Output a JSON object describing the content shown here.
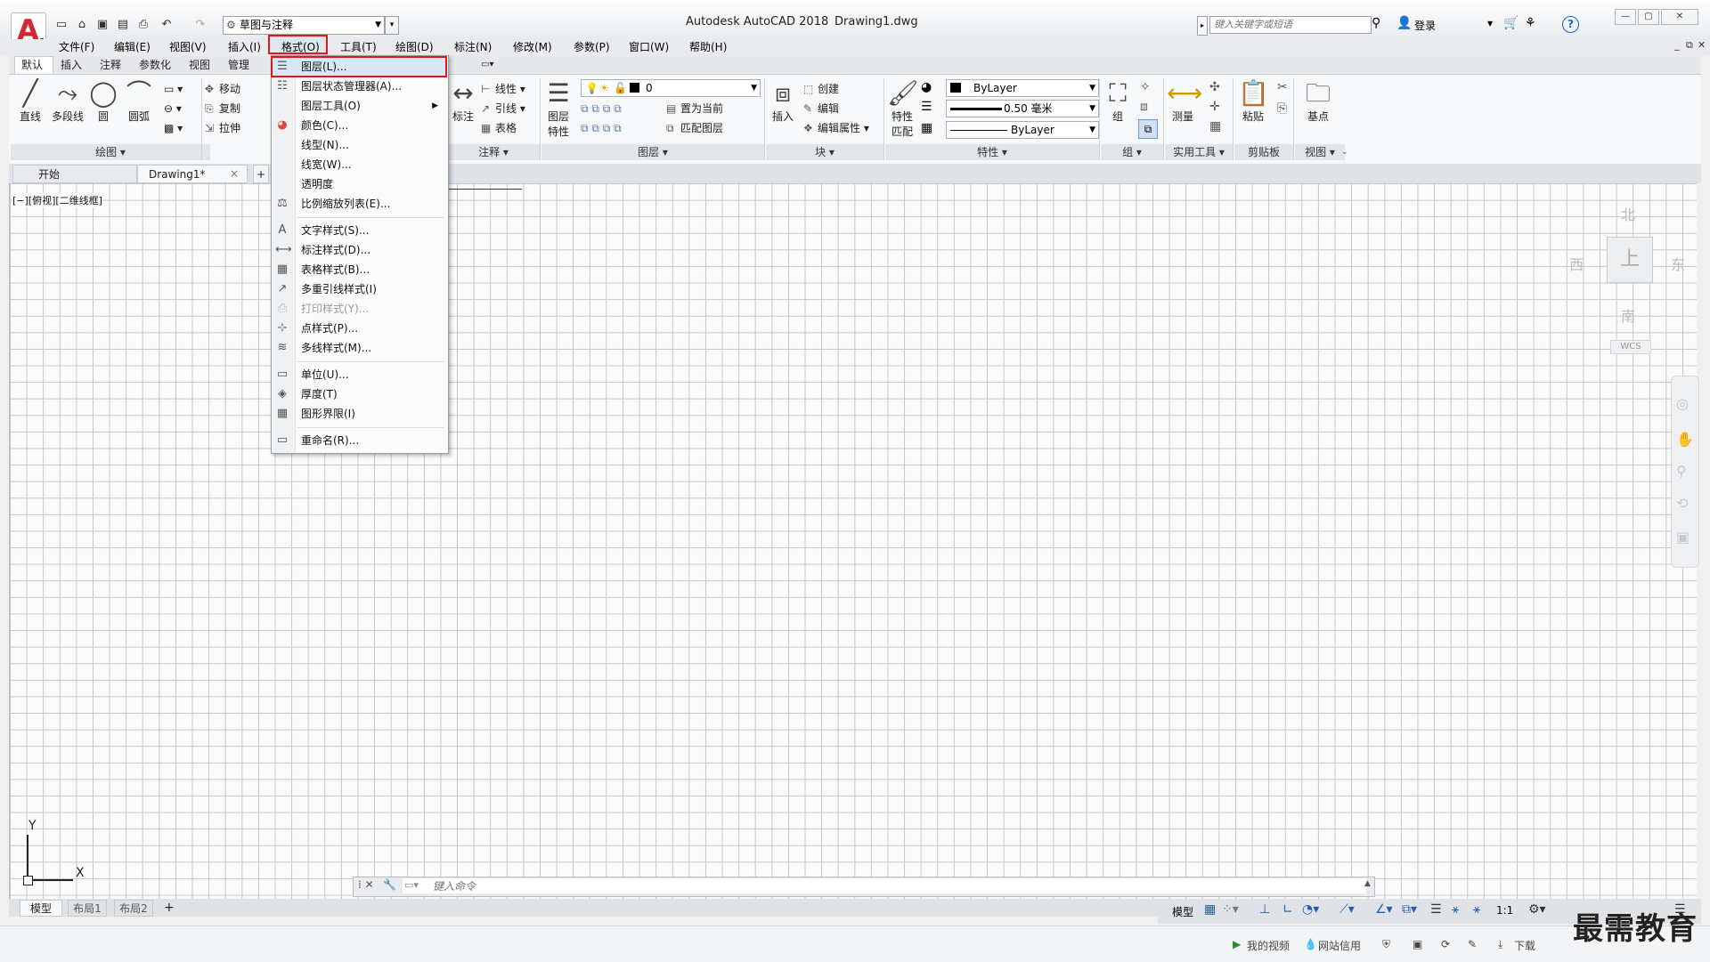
{
  "title_bar": {
    "app_name": "Autodesk AutoCAD 2018",
    "file_name": "Drawing1.dwg",
    "workspace": "草图与注释",
    "search_placeholder": "键入关键字或短语",
    "login_label": "登录"
  },
  "menubar": {
    "items": [
      "文件(F)",
      "编辑(E)",
      "视图(V)",
      "插入(I)",
      "格式(O)",
      "工具(T)",
      "绘图(D)",
      "标注(N)",
      "修改(M)",
      "参数(P)",
      "窗口(W)",
      "帮助(H)"
    ]
  },
  "ribbon_tabs": [
    "默认",
    "插入",
    "注释",
    "参数化",
    "视图",
    "管理"
  ],
  "ribbon": {
    "draw": {
      "line": "直线",
      "polyline": "多段线",
      "circle": "圆",
      "arc": "圆弧",
      "panel_title": "绘图 ▾"
    },
    "modify": {
      "move": "移动",
      "copy": "复制",
      "stretch": "拉伸"
    },
    "annotation": {
      "dimension": "标注",
      "linear": "线性",
      "leader": "引线",
      "table": "表格",
      "panel_title": "注释 ▾"
    },
    "layers": {
      "layer_props": "图层\n特性",
      "layer_value": "0",
      "set_current": "置为当前",
      "match_layer": "匹配图层",
      "panel_title": "图层 ▾"
    },
    "block": {
      "insert": "插入",
      "create": "创建",
      "edit": "编辑",
      "edit_attr": "编辑属性",
      "panel_title": "块 ▾"
    },
    "properties": {
      "match": "特性\n匹配",
      "color": "ByLayer",
      "lineweight": "0.50 毫米",
      "linetype": "ByLayer",
      "panel_title": "特性 ▾"
    },
    "groups": {
      "group": "组",
      "panel_title": "组 ▾"
    },
    "utilities": {
      "measure": "测量",
      "panel_title": "实用工具 ▾"
    },
    "clipboard": {
      "paste": "粘贴",
      "panel_title": "剪贴板"
    },
    "view": {
      "base": "基点",
      "panel_title": "视图 ▾"
    }
  },
  "doc_tabs": {
    "start": "开始",
    "drawing": "Drawing1*",
    "close": "×",
    "add": "+"
  },
  "viewport_label": "[−][俯视][二维线框]",
  "viewcube": {
    "north": "北",
    "south": "南",
    "east": "东",
    "west": "西",
    "top": "上",
    "wcs": "WCS"
  },
  "ucs": {
    "x": "X",
    "y": "Y"
  },
  "command_line": {
    "placeholder": "键入命令"
  },
  "layout_tabs": [
    "模型",
    "布局1",
    "布局2"
  ],
  "status": {
    "model": "模型",
    "scale": "1:1"
  },
  "format_menu": {
    "items": [
      {
        "label": "图层(L)...",
        "icon": "layer-icon"
      },
      {
        "label": "图层状态管理器(A)...",
        "icon": "layer-state-icon"
      },
      {
        "label": "图层工具(O)",
        "icon": "",
        "submenu": true
      },
      {
        "label": "颜色(C)...",
        "icon": "color-wheel-icon"
      },
      {
        "label": "线型(N)...",
        "icon": ""
      },
      {
        "label": "线宽(W)...",
        "icon": ""
      },
      {
        "label": "透明度",
        "icon": ""
      },
      {
        "label": "比例缩放列表(E)...",
        "icon": "scale-list-icon"
      },
      {
        "label": "文字样式(S)...",
        "icon": "text-style-icon"
      },
      {
        "label": "标注样式(D)...",
        "icon": "dim-style-icon"
      },
      {
        "label": "表格样式(B)...",
        "icon": "table-style-icon"
      },
      {
        "label": "多重引线样式(I)",
        "icon": "mleader-style-icon"
      },
      {
        "label": "打印样式(Y)...",
        "icon": "plot-style-icon",
        "disabled": true
      },
      {
        "label": "点样式(P)...",
        "icon": "point-style-icon"
      },
      {
        "label": "多线样式(M)...",
        "icon": "mline-style-icon"
      },
      {
        "label": "单位(U)...",
        "icon": "units-icon"
      },
      {
        "label": "厚度(T)",
        "icon": "thickness-icon"
      },
      {
        "label": "图形界限(I)",
        "icon": "limits-icon"
      },
      {
        "label": "重命名(R)...",
        "icon": "rename-icon"
      }
    ]
  },
  "browser_bar": {
    "my_video": "我的视频",
    "credit": "网站信用",
    "download": "下载"
  },
  "watermark": "最需教育",
  "colors": {
    "accent_red": "#e01818",
    "autocad_red": "#d6262f",
    "status_blue": "#1e5fb3"
  }
}
